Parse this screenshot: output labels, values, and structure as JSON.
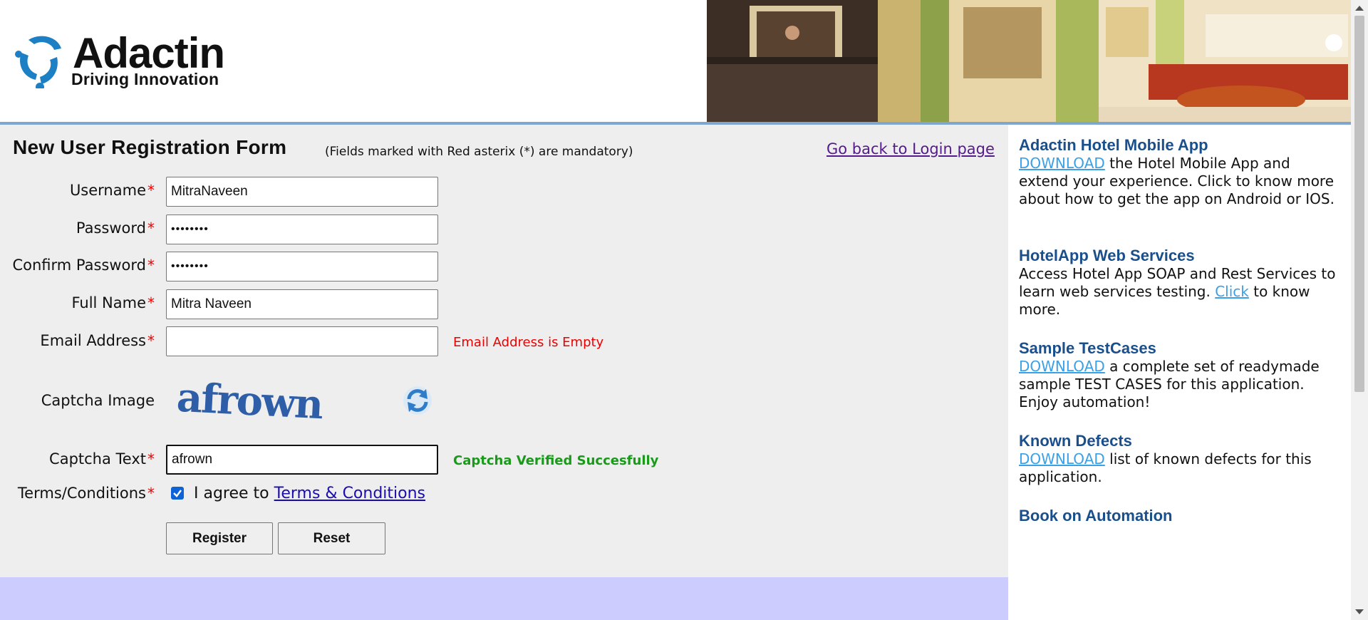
{
  "header": {
    "logo_word": "Adactin",
    "logo_tagline": "Driving Innovation"
  },
  "form": {
    "title": "New User Registration Form",
    "subtitle": "(Fields marked with Red asterix (*) are mandatory)",
    "back_link": "Go back to Login page",
    "asterisk": "*",
    "fields": {
      "username": {
        "label": "Username",
        "value": "MitraNaveen"
      },
      "password": {
        "label": "Password",
        "value": "••••••••"
      },
      "confirm_password": {
        "label": "Confirm Password",
        "value": "••••••••"
      },
      "full_name": {
        "label": "Full Name",
        "value": "Mitra Naveen"
      },
      "email": {
        "label": "Email Address",
        "value": "",
        "error": "Email Address is Empty"
      },
      "captcha_image": {
        "label": "Captcha Image",
        "text": "afrown"
      },
      "captcha_text": {
        "label": "Captcha Text",
        "value": "afrown",
        "status": "Captcha Verified Succesfully"
      },
      "terms": {
        "label": "Terms/Conditions",
        "agree_prefix": "I agree to",
        "link": "Terms & Conditions",
        "checked": true
      }
    },
    "buttons": {
      "register": "Register",
      "reset": "Reset"
    }
  },
  "sidebar": {
    "sections": [
      {
        "heading": "Adactin Hotel Mobile App",
        "link": "DOWNLOAD",
        "text": " the Hotel Mobile App and extend your experience. Click to know more about how to get the app on Android or IOS."
      },
      {
        "heading": "HotelApp Web Services",
        "text_before": "Access Hotel App SOAP and Rest Services to learn web services testing. ",
        "link": "Click",
        "text_after": " to know more."
      },
      {
        "heading": "Sample TestCases",
        "link": "DOWNLOAD",
        "text": " a complete set of readymade sample TEST CASES for this application. Enjoy automation!"
      },
      {
        "heading": "Known Defects",
        "link": "DOWNLOAD",
        "text": " list of known defects for this application."
      },
      {
        "heading": "Book on Automation"
      }
    ]
  },
  "colors": {
    "accent_rule": "#7ea6cf",
    "form_background": "#eeeeee",
    "footer_band": "#ccccff",
    "sidebar_heading": "#1a4f8b",
    "link": "#3ba0e6",
    "error": "#e00000",
    "success": "#1a9a1a"
  }
}
